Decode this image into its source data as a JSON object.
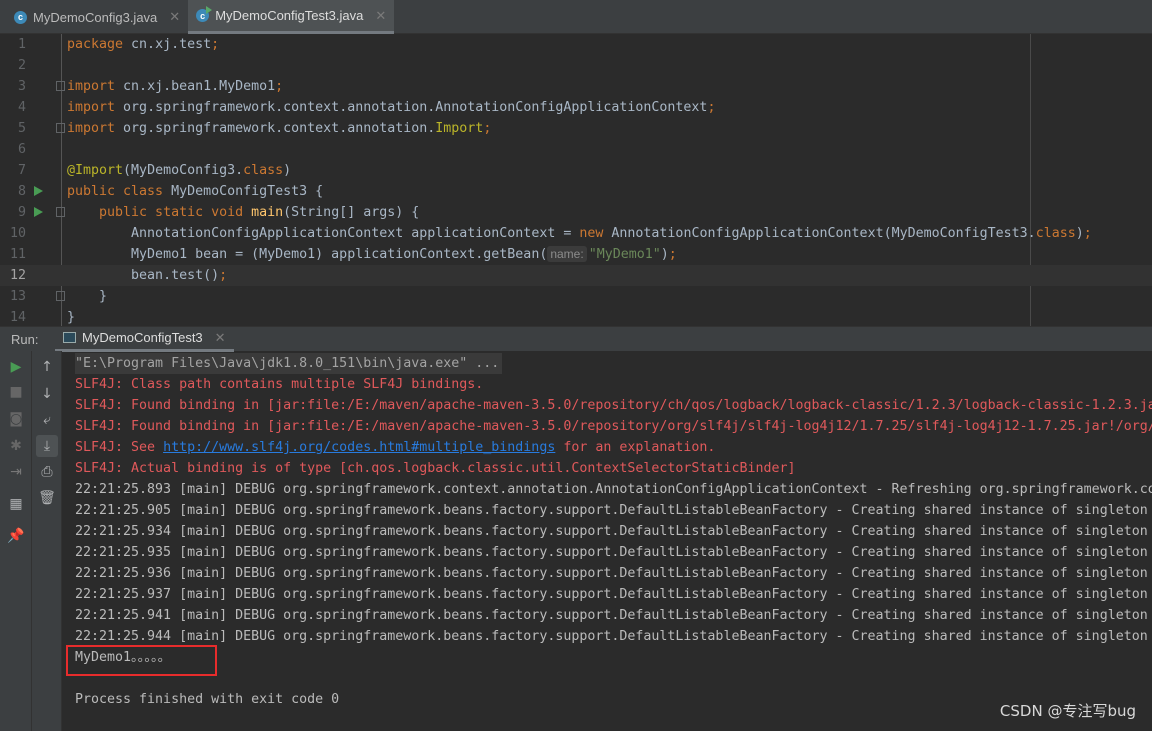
{
  "tabs": [
    {
      "label": "MyDemoConfig3.java",
      "active": false
    },
    {
      "label": "MyDemoConfigTest3.java",
      "active": true
    }
  ],
  "editor": {
    "current_line": 12,
    "lines": [
      {
        "n": "1",
        "tokens": [
          [
            "package ",
            "kw"
          ],
          [
            "cn.xj.test",
            ""
          ],
          [
            ";",
            "kw"
          ]
        ]
      },
      {
        "n": "2",
        "tokens": []
      },
      {
        "n": "3",
        "fold": true,
        "tokens": [
          [
            "import ",
            "kw"
          ],
          [
            "cn.xj.bean1.MyDemo1",
            ""
          ],
          [
            ";",
            "kw"
          ]
        ]
      },
      {
        "n": "4",
        "tokens": [
          [
            "import ",
            "kw"
          ],
          [
            "org.springframework.context.annotation.AnnotationConfigApplicationContext",
            ""
          ],
          [
            ";",
            "kw"
          ]
        ]
      },
      {
        "n": "5",
        "fold": true,
        "tokens": [
          [
            "import ",
            "kw"
          ],
          [
            "org.springframework.context.annotation.",
            ""
          ],
          [
            "Import",
            "an"
          ],
          [
            ";",
            "kw"
          ]
        ]
      },
      {
        "n": "6",
        "tokens": []
      },
      {
        "n": "7",
        "tokens": [
          [
            "@Import",
            "an"
          ],
          [
            "(MyDemoConfig3.",
            ""
          ],
          [
            "class",
            "kw"
          ],
          [
            ")",
            ""
          ]
        ]
      },
      {
        "n": "8",
        "run": true,
        "tokens": [
          [
            "public class ",
            "kw"
          ],
          [
            "MyDemoConfigTest3 {",
            ""
          ]
        ]
      },
      {
        "n": "9",
        "run": true,
        "fold": true,
        "tokens": [
          [
            "    public static void ",
            "kw"
          ],
          [
            "main",
            "fn"
          ],
          [
            "(String[] args) {",
            ""
          ]
        ]
      },
      {
        "n": "10",
        "tokens": [
          [
            "        AnnotationConfigApplicationContext applicationContext = ",
            ""
          ],
          [
            "new ",
            "kw"
          ],
          [
            "AnnotationConfigApplicationContext(MyDemoConfigTest3.",
            ""
          ],
          [
            "class",
            "kw"
          ],
          [
            ")",
            ""
          ],
          [
            ";",
            "kw"
          ]
        ]
      },
      {
        "n": "11",
        "tokens": [
          [
            "        MyDemo1 bean = (MyDemo1) applicationContext.getBean(",
            ""
          ],
          [
            "name:",
            "hint"
          ],
          [
            "\"MyDemo1\"",
            "st"
          ],
          [
            ")",
            ""
          ],
          [
            ";",
            "kw"
          ]
        ]
      },
      {
        "n": "12",
        "tokens": [
          [
            "        bean.test()",
            ""
          ],
          [
            ";",
            "kw"
          ]
        ]
      },
      {
        "n": "13",
        "fold": true,
        "tokens": [
          [
            "    }",
            ""
          ]
        ]
      },
      {
        "n": "14",
        "tokens": [
          [
            "}",
            ""
          ]
        ]
      }
    ]
  },
  "run": {
    "label": "Run:",
    "tab": "MyDemoConfigTest3"
  },
  "console": {
    "lines": [
      {
        "type": "cmd",
        "text": "\"E:\\Program Files\\Java\\jdk1.8.0_151\\bin\\java.exe\" ..."
      },
      {
        "type": "err",
        "text": "SLF4J: Class path contains multiple SLF4J bindings."
      },
      {
        "type": "err",
        "text": "SLF4J: Found binding in [jar:file:/E:/maven/apache-maven-3.5.0/repository/ch/qos/logback/logback-classic/1.2.3/logback-classic-1.2.3.ja"
      },
      {
        "type": "err",
        "text": "SLF4J: Found binding in [jar:file:/E:/maven/apache-maven-3.5.0/repository/org/slf4j/slf4j-log4j12/1.7.25/slf4j-log4j12-1.7.25.jar!/org/"
      },
      {
        "type": "err",
        "pre": "SLF4J: See ",
        "link": "http://www.slf4j.org/codes.html#multiple_bindings",
        "text": " for an explanation."
      },
      {
        "type": "err",
        "text": "SLF4J: Actual binding is of type [ch.qos.logback.classic.util.ContextSelectorStaticBinder]"
      },
      {
        "type": "out",
        "text": "22:21:25.893 [main] DEBUG org.springframework.context.annotation.AnnotationConfigApplicationContext - Refreshing org.springframework.co"
      },
      {
        "type": "out",
        "text": "22:21:25.905 [main] DEBUG org.springframework.beans.factory.support.DefaultListableBeanFactory - Creating shared instance of singleton"
      },
      {
        "type": "out",
        "text": "22:21:25.934 [main] DEBUG org.springframework.beans.factory.support.DefaultListableBeanFactory - Creating shared instance of singleton"
      },
      {
        "type": "out",
        "text": "22:21:25.935 [main] DEBUG org.springframework.beans.factory.support.DefaultListableBeanFactory - Creating shared instance of singleton"
      },
      {
        "type": "out",
        "text": "22:21:25.936 [main] DEBUG org.springframework.beans.factory.support.DefaultListableBeanFactory - Creating shared instance of singleton"
      },
      {
        "type": "out",
        "text": "22:21:25.937 [main] DEBUG org.springframework.beans.factory.support.DefaultListableBeanFactory - Creating shared instance of singleton"
      },
      {
        "type": "out",
        "text": "22:21:25.941 [main] DEBUG org.springframework.beans.factory.support.DefaultListableBeanFactory - Creating shared instance of singleton"
      },
      {
        "type": "out",
        "text": "22:21:25.944 [main] DEBUG org.springframework.beans.factory.support.DefaultListableBeanFactory - Creating shared instance of singleton"
      },
      {
        "type": "out",
        "text": "MyDemo1。。。。。"
      },
      {
        "type": "out",
        "text": ""
      },
      {
        "type": "out",
        "text": "Process finished with exit code 0"
      }
    ]
  },
  "watermark": "CSDN @专注写bug",
  "colors": {
    "highlight_box": "#e82c2c",
    "error": "#e0595b",
    "link": "#287bde"
  }
}
